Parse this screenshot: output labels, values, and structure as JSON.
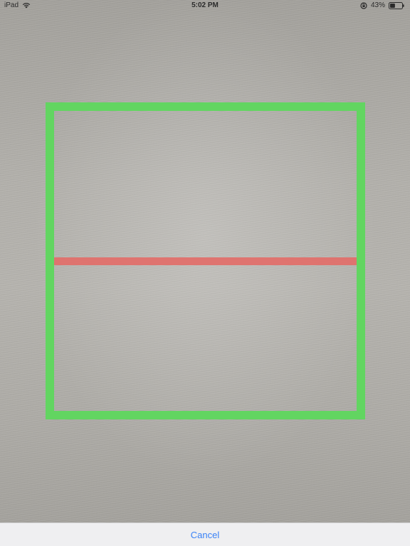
{
  "status_bar": {
    "device": "iPad",
    "time": "5:02 PM",
    "battery_percent": "43%",
    "battery_level": 0.43,
    "icons": [
      "wifi-icon",
      "lock-rotation-icon",
      "battery-icon"
    ]
  },
  "scanner": {
    "frame_color": "#5fd65e",
    "scan_line_color": "#e0706b"
  },
  "footer": {
    "cancel_label": "Cancel",
    "cancel_color": "#3a82f6"
  }
}
